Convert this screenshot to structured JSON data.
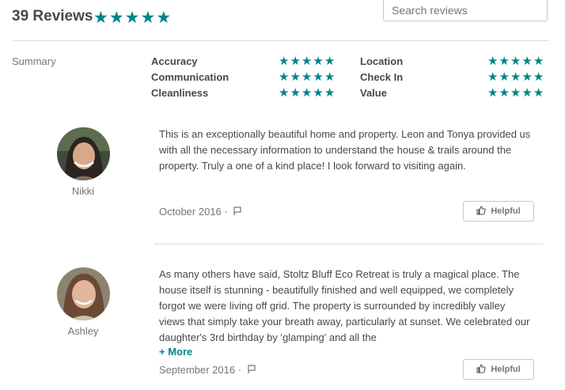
{
  "header": {
    "review_count": "39 Reviews",
    "rating_stars": 5,
    "search_placeholder": "Search reviews"
  },
  "summary": {
    "label": "Summary",
    "categories": [
      {
        "name": "Accuracy",
        "stars": 5
      },
      {
        "name": "Communication",
        "stars": 5
      },
      {
        "name": "Cleanliness",
        "stars": 5
      },
      {
        "name": "Location",
        "stars": 5
      },
      {
        "name": "Check In",
        "stars": 5
      },
      {
        "name": "Value",
        "stars": 5
      }
    ]
  },
  "reviews": [
    {
      "reviewer": "Nikki",
      "text": "This is an exceptionally beautiful home and property. Leon and Tonya provided us with all the necessary information to understand the house & trails around the property. Truly a one of a kind place! I look forward to visiting again.",
      "date": "October 2016 ·",
      "helpful_label": "Helpful"
    },
    {
      "reviewer": "Ashley",
      "text": "As many others have said, Stoltz Bluff Eco Retreat is truly a magical place. The house itself is stunning - beautifully finished and well equipped, we completely forgot we were living off grid. The property is surrounded by incredibly valley views that simply take your breath away, particularly at sunset. We celebrated our daughter's 3rd birthday by 'glamping' and all the",
      "more_label": "+ More",
      "date": "September 2016 ·",
      "helpful_label": "Helpful"
    }
  ],
  "colors": {
    "accent": "#008489",
    "text": "#484848",
    "muted": "#767676",
    "border": "#dcdcdc"
  }
}
